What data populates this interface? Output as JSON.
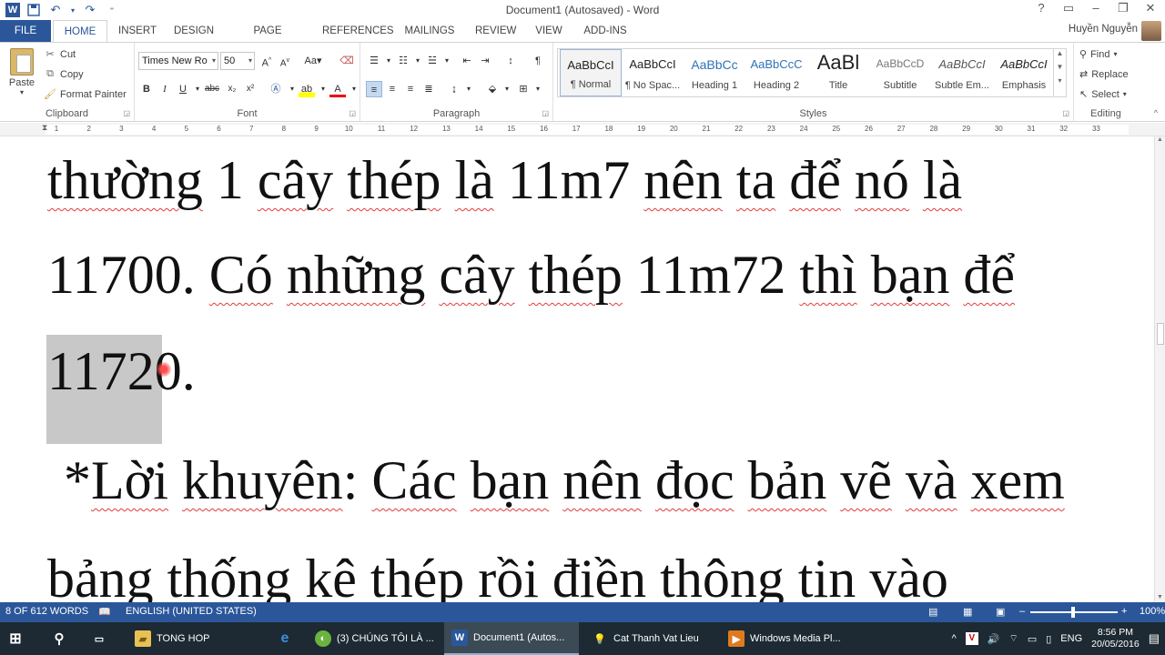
{
  "window": {
    "title": "Document1 (Autosaved) - Word",
    "user": "Huyền Nguyễn"
  },
  "tabs": [
    "FILE",
    "HOME",
    "INSERT",
    "DESIGN",
    "PAGE LAYOUT",
    "REFERENCES",
    "MAILINGS",
    "REVIEW",
    "VIEW",
    "ADD-INS"
  ],
  "ribbon": {
    "clipboard": {
      "label": "Clipboard",
      "paste": "Paste",
      "cut": "Cut",
      "copy": "Copy",
      "format_painter": "Format Painter"
    },
    "font": {
      "label": "Font",
      "name": "Times New Ro",
      "size": "50"
    },
    "paragraph": {
      "label": "Paragraph"
    },
    "styles": {
      "label": "Styles",
      "items": [
        {
          "sample": "AaBbCcI",
          "name": "¶ Normal"
        },
        {
          "sample": "AaBbCcI",
          "name": "¶ No Spac..."
        },
        {
          "sample": "AaBbCc",
          "name": "Heading 1"
        },
        {
          "sample": "AaBbCcC",
          "name": "Heading 2"
        },
        {
          "sample": "AaBl",
          "name": "Title"
        },
        {
          "sample": "AaBbCcD",
          "name": "Subtitle"
        },
        {
          "sample": "AaBbCcI",
          "name": "Subtle Em..."
        },
        {
          "sample": "AaBbCcI",
          "name": "Emphasis"
        }
      ]
    },
    "editing": {
      "label": "Editing",
      "find": "Find",
      "replace": "Replace",
      "select": "Select"
    }
  },
  "ruler": [
    "1",
    "2",
    "3",
    "4",
    "5",
    "6",
    "7",
    "8",
    "9",
    "10",
    "11",
    "12",
    "13",
    "14",
    "15",
    "16",
    "17",
    "18",
    "19",
    "20",
    "21",
    "22",
    "23",
    "24",
    "25",
    "26",
    "27",
    "28",
    "29",
    "30",
    "31",
    "32",
    "33"
  ],
  "document": {
    "line1": {
      "a": "thường",
      "b": " 1 ",
      "c": "cây",
      "d": " ",
      "e": "thép",
      "f": " ",
      "g": "là",
      "h": " 11m7 ",
      "i": "nên",
      "j": " ",
      "k": "ta",
      "l": " ",
      "m": "để",
      "n": " ",
      "o": "nó",
      "p": " ",
      "q": "là"
    },
    "line2": {
      "a": "11700. ",
      "b": "Có",
      "c": " ",
      "d": "những",
      "e": " ",
      "f": "cây",
      "g": " ",
      "h": "thép",
      "i": " 11m72 ",
      "j": "thì",
      "k": " ",
      "l": "bạn",
      "m": " ",
      "n": "để"
    },
    "line3": "11720.",
    "line4": {
      "a": "*",
      "b": "Lời",
      "c": " ",
      "d": "khuyên",
      "e": ": ",
      "f": "Các",
      "g": " ",
      "h": "bạn",
      "i": " ",
      "j": "nên",
      "k": " ",
      "l": "đọc",
      "m": " ",
      "n": "bản",
      "o": " ",
      "p": "vẽ",
      "q": " ",
      "r": "và",
      "s": " ",
      "t": "xem"
    },
    "line5": "bảng thống kê thép rồi điền thông tin vào"
  },
  "status": {
    "words": "8 OF 612 WORDS",
    "language": "ENGLISH (UNITED STATES)",
    "zoom": "100%"
  },
  "taskbar": {
    "items": [
      "TONG HOP",
      "(3) CHÚNG TÔI LÀ ...",
      "Document1 (Autos...",
      "Cat Thanh Vat Lieu",
      "Windows Media Pl..."
    ],
    "lang": "ENG",
    "time": "8:56 PM",
    "date": "20/05/2016"
  }
}
